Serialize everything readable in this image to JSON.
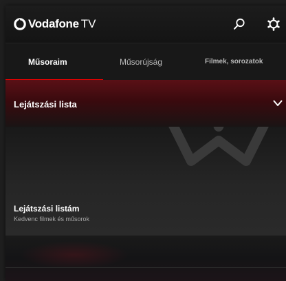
{
  "app": {
    "brand_name": "Vodafone",
    "brand_suffix": "TV"
  },
  "header": {
    "icons": [
      "search-icon",
      "gear-icon"
    ]
  },
  "tabs": [
    {
      "label": "Műsoraim",
      "active": true
    },
    {
      "label": "Műsorújság",
      "active": false
    },
    {
      "label": "Filmek, sorozatok",
      "active": false
    }
  ],
  "section": {
    "title": "Lejátszási lista"
  },
  "playlist_card": {
    "title": "Lejátszási listám",
    "subtitle": "Kedvenc filmek és műsorok"
  },
  "colors": {
    "accent": "#e60000",
    "background": "#141414"
  }
}
